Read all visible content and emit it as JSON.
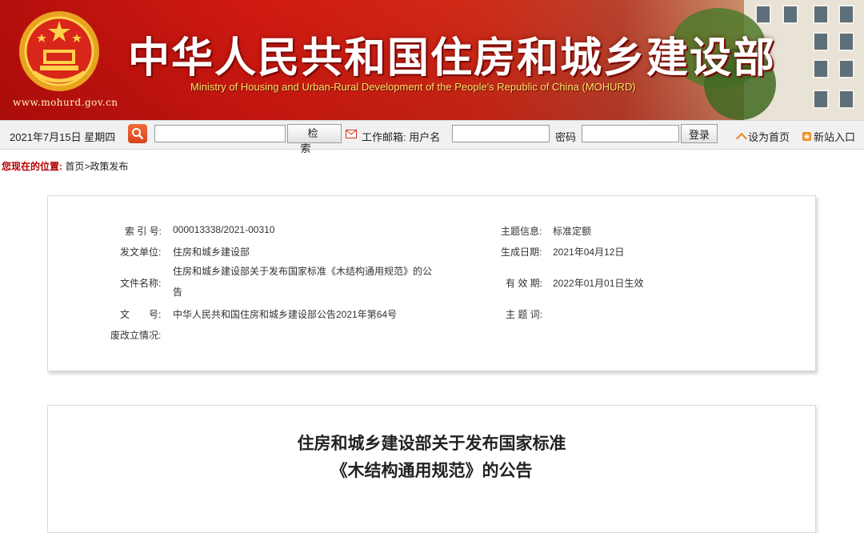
{
  "banner": {
    "title_cn": "中华人民共和国住房和城乡建设部",
    "title_en": "Ministry of Housing and Urban-Rural Development of the People's Republic of China (MOHURD)",
    "site_url": "www.mohurd.gov.cn",
    "colors": {
      "brand_red": "#c8140f",
      "gold": "#ffe36a"
    }
  },
  "toolbar": {
    "date": "2021年7月15日 星期四",
    "search_button": "检索",
    "mail_label": "工作邮箱: 用户名",
    "password_label": "密码",
    "login_button": "登录",
    "set_home": "设为首页",
    "new_site": "新站入口",
    "icons": [
      "search-icon",
      "mail-icon",
      "home-icon",
      "rss-icon"
    ]
  },
  "breadcrumb": {
    "label": "您现在的位置:",
    "path": "首页>政策发布"
  },
  "meta": {
    "index_label": "索 引 号:",
    "index_value": "000013338/2021-00310",
    "topic_label": "主题信息:",
    "topic_value": "标准定额",
    "issuer_label": "发文单位:",
    "issuer_value": "住房和城乡建设部",
    "date_label": "生成日期:",
    "date_value": "2021年04月12日",
    "filename_label": "文件名称:",
    "filename_value": "住房和城乡建设部关于发布国家标准《木结构通用规范》的公告",
    "validity_label": "有 效 期:",
    "validity_value": "2022年01月01日生效",
    "docno_label": "文　　号:",
    "docno_value": "中华人民共和国住房和城乡建设部公告2021年第64号",
    "keywords_label": "主 题 词:",
    "keywords_value": "",
    "status_label": "废改立情况:",
    "status_value": ""
  },
  "article": {
    "title_line1": "住房和城乡建设部关于发布国家标准",
    "title_line2": "《木结构通用规范》的公告"
  }
}
